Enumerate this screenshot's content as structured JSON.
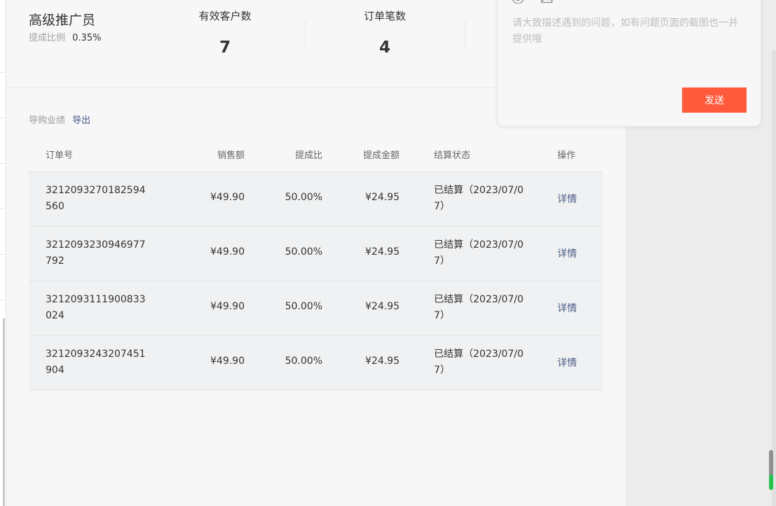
{
  "header": {
    "role_title": "高级推广员",
    "rate_label": "提成比例",
    "rate_value": "0.35%",
    "stats": [
      {
        "label": "有效客户数",
        "value": "7"
      },
      {
        "label": "订单笔数",
        "value": "4"
      }
    ]
  },
  "section": {
    "title": "导购业绩",
    "export_label": "导出"
  },
  "table": {
    "columns": [
      "订单号",
      "销售额",
      "提成比",
      "提成金额",
      "结算状态",
      "操作"
    ],
    "rows": [
      {
        "order_no": "3212093270182594560",
        "sales": "¥49.90",
        "ratio": "50.00%",
        "amount": "¥24.95",
        "status": "已结算（2023/07/07）",
        "action": "详情"
      },
      {
        "order_no": "3212093230946977792",
        "sales": "¥49.90",
        "ratio": "50.00%",
        "amount": "¥24.95",
        "status": "已结算（2023/07/07）",
        "action": "详情"
      },
      {
        "order_no": "3212093111900833024",
        "sales": "¥49.90",
        "ratio": "50.00%",
        "amount": "¥24.95",
        "status": "已结算（2023/07/07）",
        "action": "详情"
      },
      {
        "order_no": "3212093243207451904",
        "sales": "¥49.90",
        "ratio": "50.00%",
        "amount": "¥24.95",
        "status": "已结算（2023/07/07）",
        "action": "详情"
      }
    ]
  },
  "feedback": {
    "icons": [
      "emoji-icon",
      "image-upload-icon"
    ],
    "placeholder": "请大致描述遇到的问题，如有问题页面的截图也一并提供哦",
    "send_label": "发送",
    "send_color": "#ff5a3c"
  },
  "colors": {
    "link": "#4a5c86",
    "panel_bg": "#f7f7f7",
    "row_bg": "#f0f1f2"
  }
}
